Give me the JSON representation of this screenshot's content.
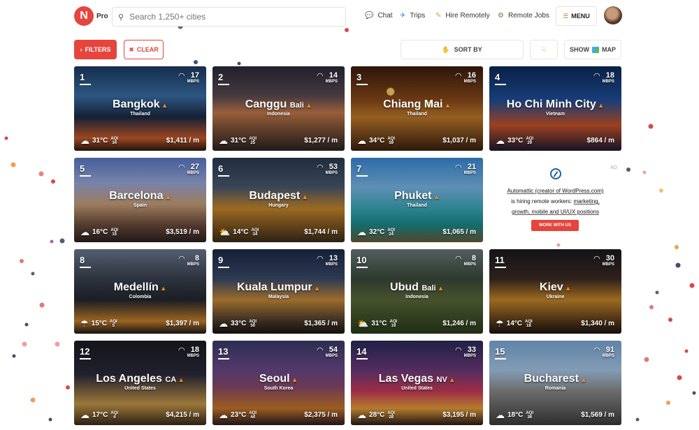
{
  "brand": {
    "logo_letter": "N",
    "tier": "Pro"
  },
  "search": {
    "placeholder": "Search 1,250+ cities"
  },
  "nav": {
    "chat": "Chat",
    "trips": "Trips",
    "hire": "Hire Remotely",
    "jobs": "Remote Jobs",
    "menu": "MENU"
  },
  "toolbar": {
    "filters": "FILTERS",
    "clear": "CLEAR",
    "sort": "SORT BY",
    "show": "SHOW",
    "map": "MAP"
  },
  "wifi_unit": "MBPS",
  "aqi_label": "AQI",
  "cities": [
    {
      "rank": "1",
      "name": "Bangkok",
      "suffix": "",
      "country": "Thailand",
      "mbps": "17",
      "temp": "31°C",
      "aqi": "34",
      "cost": "$1,411 / m",
      "weather": "cloud-icon"
    },
    {
      "rank": "2",
      "name": "Canggu",
      "suffix": "Bali",
      "country": "Indonesia",
      "mbps": "14",
      "temp": "31°C",
      "aqi": "25",
      "cost": "$1,277 / m",
      "weather": "cloud-icon"
    },
    {
      "rank": "3",
      "name": "Chiang Mai",
      "suffix": "",
      "country": "Thailand",
      "mbps": "16",
      "temp": "34°C",
      "aqi": "59",
      "cost": "$1,037 / m",
      "weather": "cloud-icon"
    },
    {
      "rank": "4",
      "name": "Ho Chi Minh City",
      "suffix": "",
      "country": "Vietnam",
      "mbps": "18",
      "temp": "33°C",
      "aqi": "29",
      "cost": "$864 / m",
      "weather": "cloud-icon"
    },
    {
      "rank": "5",
      "name": "Barcelona",
      "suffix": "",
      "country": "Spain",
      "mbps": "27",
      "temp": "16°C",
      "aqi": "15",
      "cost": "$3,519 / m",
      "weather": "cloud-icon"
    },
    {
      "rank": "6",
      "name": "Budapest",
      "suffix": "",
      "country": "Hungary",
      "mbps": "53",
      "temp": "14°C",
      "aqi": "34",
      "cost": "$1,744 / m",
      "weather": "sun-cloud-icon"
    },
    {
      "rank": "7",
      "name": "Phuket",
      "suffix": "",
      "country": "Thailand",
      "mbps": "21",
      "temp": "32°C",
      "aqi": "24",
      "cost": "$1,065 / m",
      "weather": "cloud-icon"
    },
    {
      "rank": "8",
      "name": "Medellín",
      "suffix": "",
      "country": "Colombia",
      "mbps": "8",
      "temp": "15°C",
      "aqi": "5",
      "cost": "$1,397 / m",
      "weather": "rain-icon"
    },
    {
      "rank": "9",
      "name": "Kuala Lumpur",
      "suffix": "",
      "country": "Malaysia",
      "mbps": "13",
      "temp": "33°C",
      "aqi": "50",
      "cost": "$1,365 / m",
      "weather": "cloud-icon"
    },
    {
      "rank": "10",
      "name": "Ubud",
      "suffix": "Bali",
      "country": "Indonesia",
      "mbps": "8",
      "temp": "31°C",
      "aqi": "19",
      "cost": "$1,246 / m",
      "weather": "sun-cloud-icon"
    },
    {
      "rank": "11",
      "name": "Kiev",
      "suffix": "",
      "country": "Ukraine",
      "mbps": "30",
      "temp": "14°C",
      "aqi": "18",
      "cost": "$1,340 / m",
      "weather": "rain-icon"
    },
    {
      "rank": "12",
      "name": "Los Angeles",
      "suffix": "CA",
      "country": "United States",
      "mbps": "18",
      "temp": "17°C",
      "aqi": "4",
      "cost": "$4,215 / m",
      "weather": "cloud-icon"
    },
    {
      "rank": "13",
      "name": "Seoul",
      "suffix": "",
      "country": "South Korea",
      "mbps": "54",
      "temp": "23°C",
      "aqi": "44",
      "cost": "$2,375 / m",
      "weather": "cloud-icon"
    },
    {
      "rank": "14",
      "name": "Las Vegas",
      "suffix": "NV",
      "country": "United States",
      "mbps": "33",
      "temp": "28°C",
      "aqi": "28",
      "cost": "$3,195 / m",
      "weather": "cloud-icon"
    },
    {
      "rank": "15",
      "name": "Bucharest",
      "suffix": "",
      "country": "Romania",
      "mbps": "91",
      "temp": "18°C",
      "aqi": "36",
      "cost": "$1,569 / m",
      "weather": "cloud-icon"
    }
  ],
  "ad": {
    "label": "AD",
    "line1": "Automattic (creator of WordPress.com)",
    "line2": "is hiring remote workers: ",
    "link1": "marketing,",
    "link2": "growth, mobile and UI/UX positions",
    "cta": "WORK WITH US"
  },
  "colors": {
    "accent": "#e5453c",
    "fire": "#ff8a1e"
  }
}
